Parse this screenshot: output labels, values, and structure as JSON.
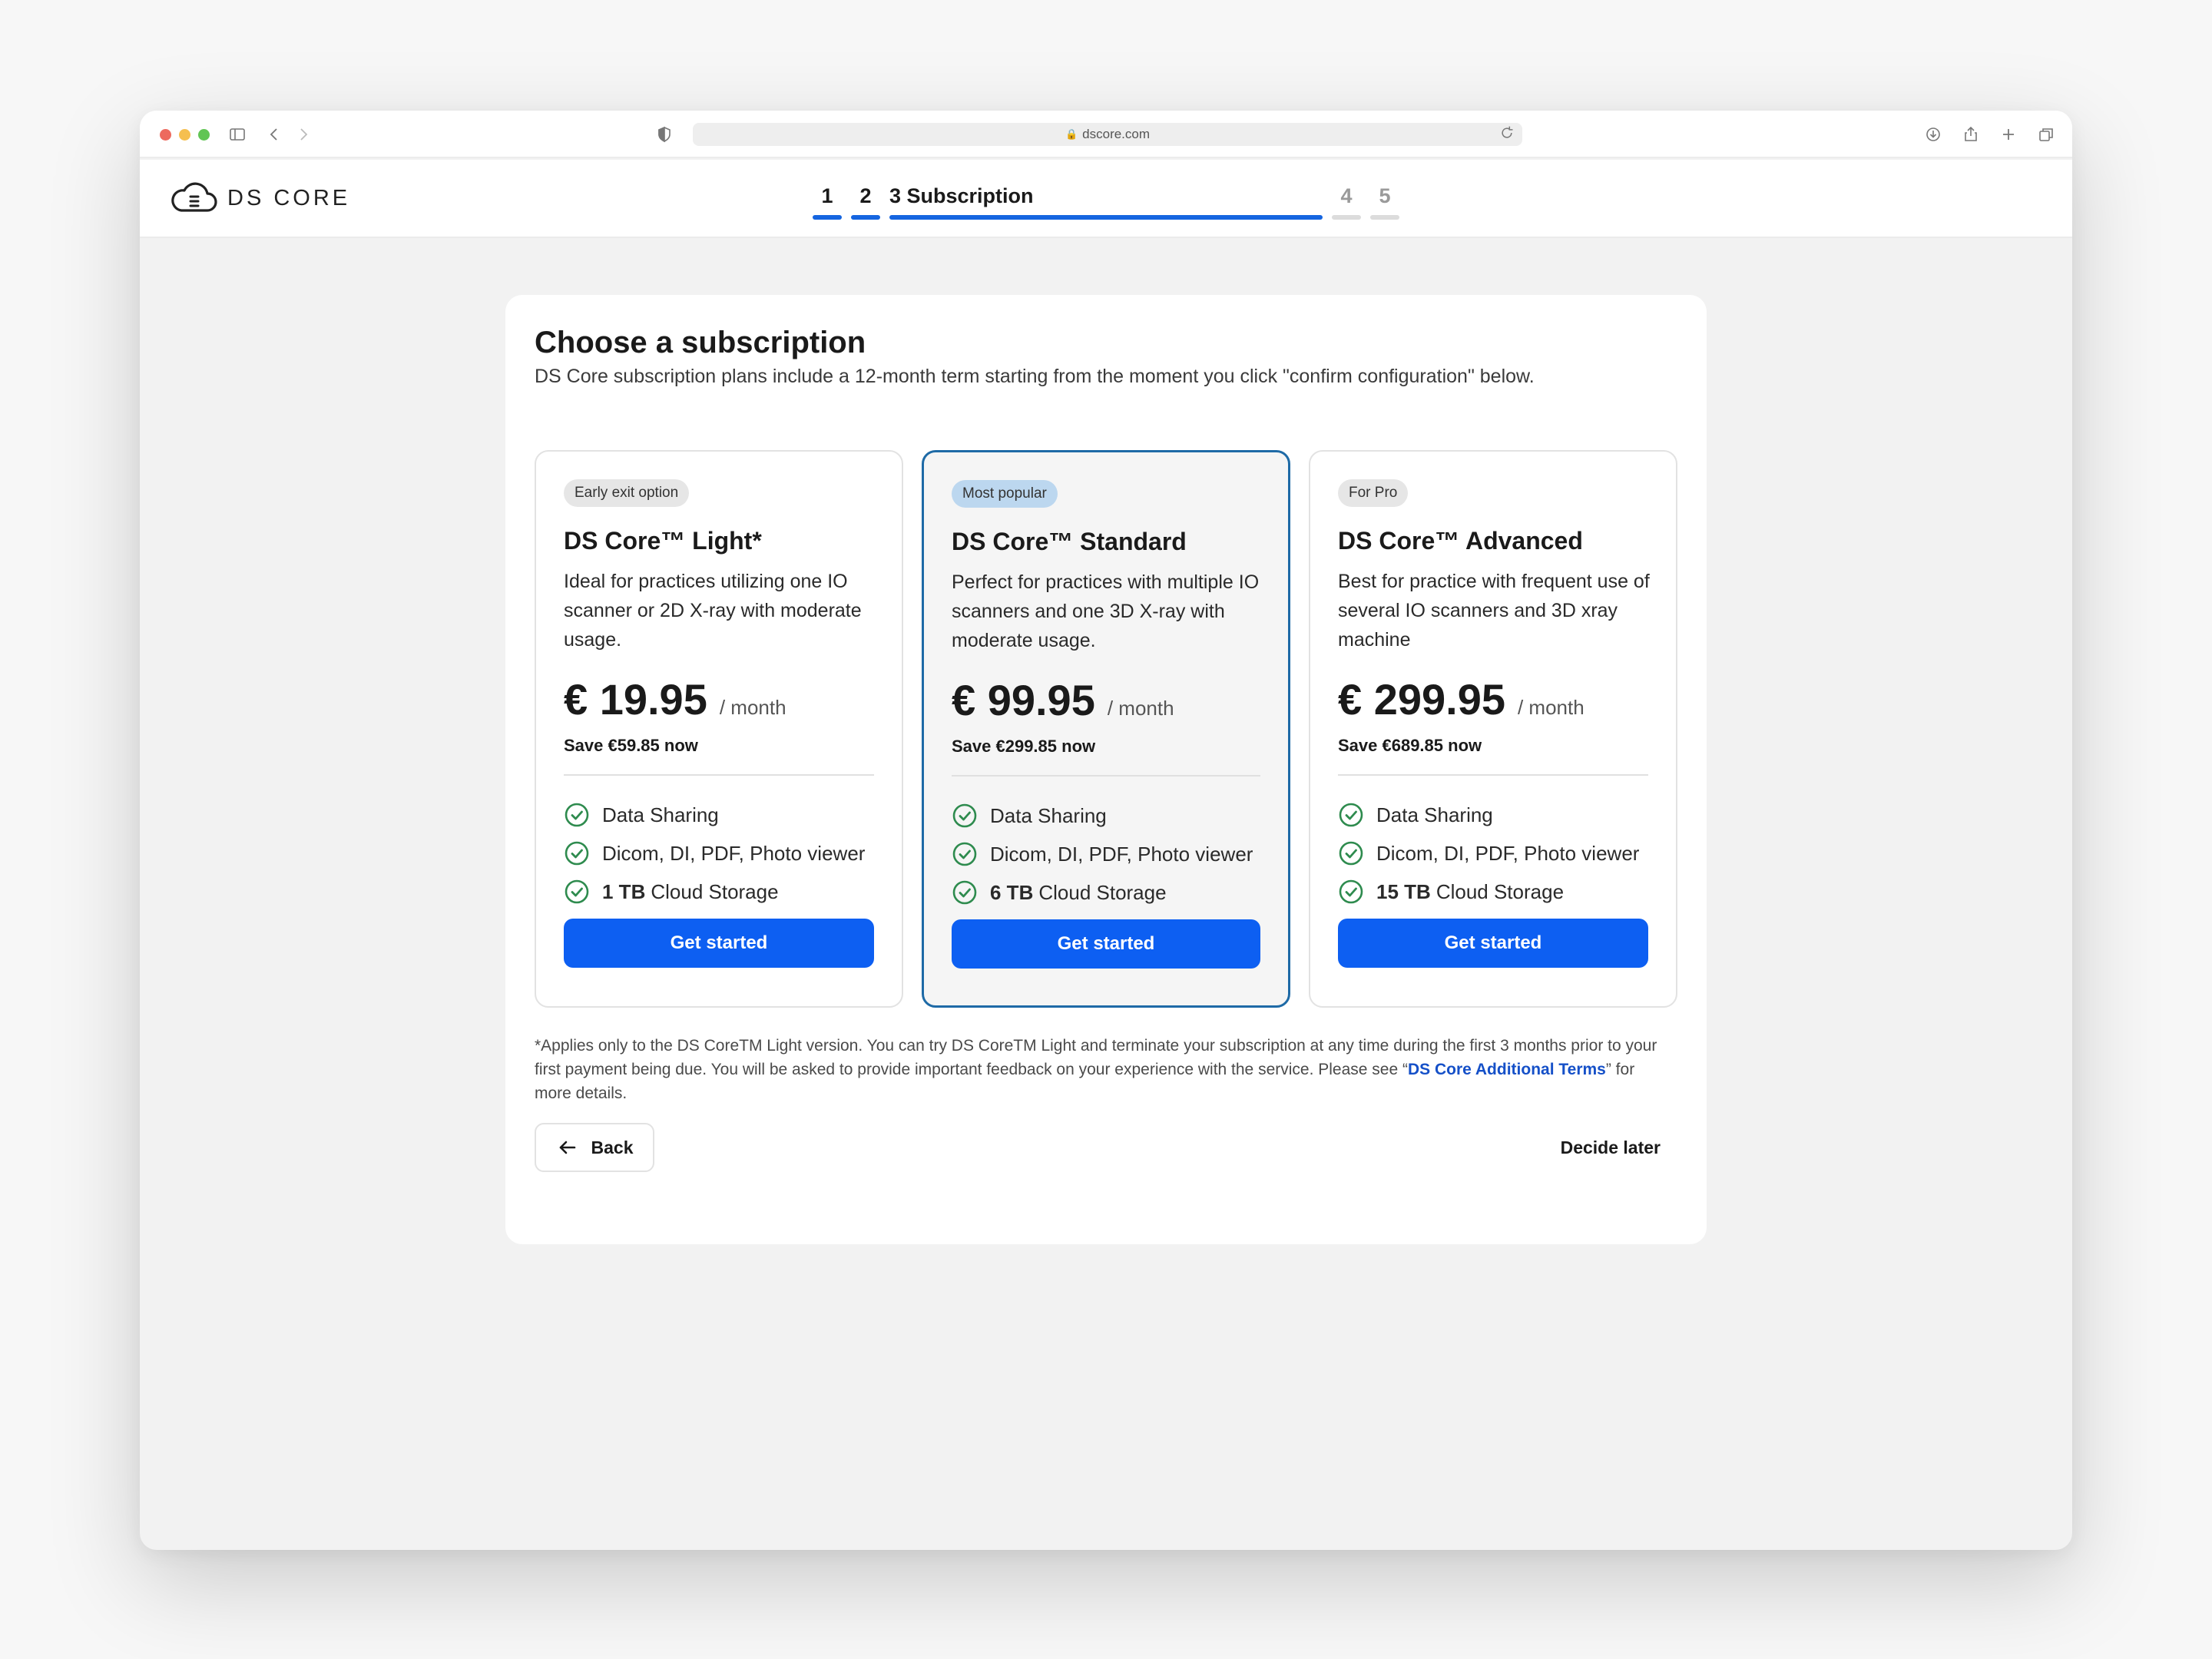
{
  "browser": {
    "url": "dscore.com",
    "traffic_colors": [
      "#ed6a5e",
      "#f5bf4f",
      "#61c554"
    ]
  },
  "brand": {
    "name": "DS CORE"
  },
  "stepper": {
    "steps": [
      {
        "label": "1",
        "state": "done"
      },
      {
        "label": "2",
        "state": "done"
      },
      {
        "label": "3 Subscription",
        "state": "current"
      },
      {
        "label": "4",
        "state": "future"
      },
      {
        "label": "5",
        "state": "future"
      }
    ],
    "accent": "#1565e0"
  },
  "page": {
    "title": "Choose a subscription",
    "subtitle": "DS Core subscription plans include a 12-month term starting from the moment you click \"confirm configuration\" below."
  },
  "plans": [
    {
      "badge": "Early exit option",
      "name": "DS Core™ Light*",
      "description": "Ideal for practices utilizing one IO scanner or 2D X-ray with moderate usage.",
      "price": "€ 19.95",
      "per": "/ month",
      "save": "Save €59.85 now",
      "features": [
        {
          "bold": "",
          "text": "Data Sharing"
        },
        {
          "bold": "",
          "text": "Dicom, DI, PDF, Photo viewer"
        },
        {
          "bold": "1 TB",
          "text": "Cloud Storage"
        }
      ],
      "cta": "Get started"
    },
    {
      "badge": "Most popular",
      "name": "DS Core™ Standard",
      "description": "Perfect for practices with multiple IO scanners and one 3D X-ray with moderate usage.",
      "price": "€ 99.95",
      "per": "/ month",
      "save": "Save €299.85 now",
      "features": [
        {
          "bold": "",
          "text": "Data Sharing"
        },
        {
          "bold": "",
          "text": "Dicom, DI, PDF, Photo viewer"
        },
        {
          "bold": "6 TB",
          "text": "Cloud Storage"
        }
      ],
      "cta": "Get started"
    },
    {
      "badge": "For Pro",
      "name": "DS Core™ Advanced",
      "description": "Best for practice with frequent use of several IO scanners and 3D xray machine",
      "price": "€ 299.95",
      "per": "/ month",
      "save": "Save €689.85 now",
      "features": [
        {
          "bold": "",
          "text": "Data Sharing"
        },
        {
          "bold": "",
          "text": "Dicom, DI, PDF, Photo viewer"
        },
        {
          "bold": "15 TB",
          "text": "Cloud Storage"
        }
      ],
      "cta": "Get started"
    }
  ],
  "footnote": {
    "before": "*Applies only to the DS CoreTM Light version. You can try DS CoreTM Light and terminate your subscription at any time during the first 3 months prior to your first payment being due. You will be asked to provide important feedback on your experience with the service. Please see “",
    "link": "DS Core Additional Terms",
    "after": "” for more details."
  },
  "actions": {
    "back": "Back",
    "later": "Decide later"
  },
  "colors": {
    "primary": "#0d5ff2",
    "check": "#2e8b4e",
    "popular_border": "#1e6aa6",
    "popular_badge": "#bcd7ef"
  }
}
